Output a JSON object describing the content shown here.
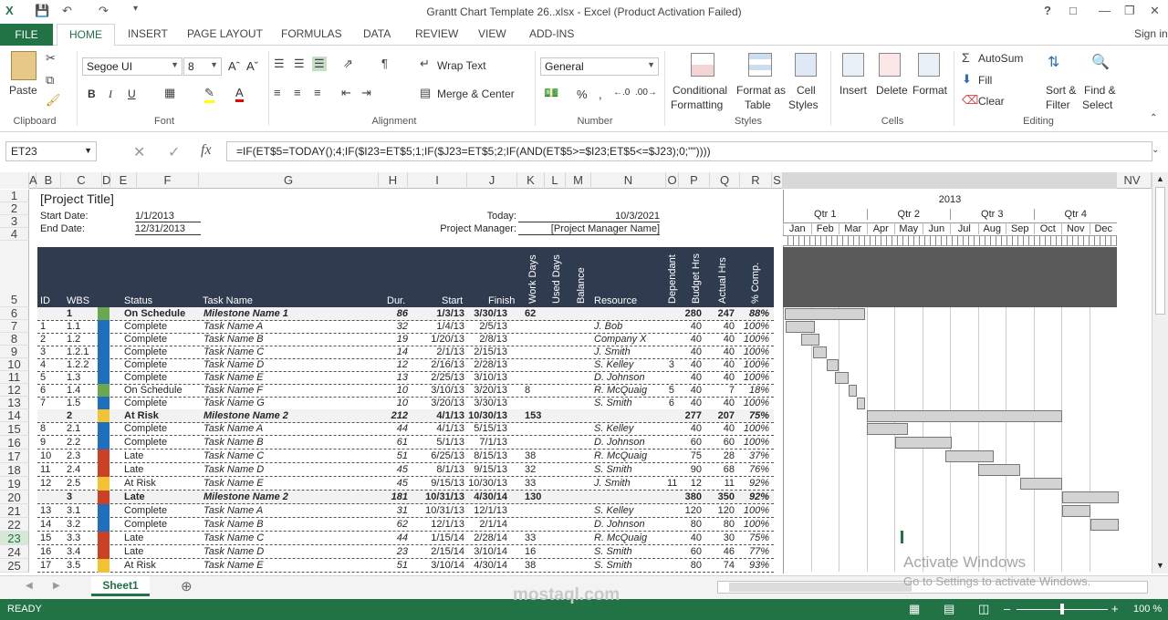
{
  "window": {
    "title": "Grantt Chart Template 26..xlsx - Excel (Product Activation Failed)",
    "help": "?",
    "signin": "Sign in"
  },
  "tabs": [
    "FILE",
    "HOME",
    "INSERT",
    "PAGE LAYOUT",
    "FORMULAS",
    "DATA",
    "REVIEW",
    "VIEW",
    "ADD-INS"
  ],
  "ribbon": {
    "clipboard": {
      "paste": "Paste",
      "label": "Clipboard"
    },
    "font": {
      "name": "Segoe UI",
      "size": "8",
      "label": "Font",
      "bold": "B",
      "italic": "I",
      "underline": "U"
    },
    "alignment": {
      "wrap": "Wrap Text",
      "merge": "Merge & Center",
      "label": "Alignment"
    },
    "number": {
      "format": "General",
      "label": "Number",
      "percent": "%"
    },
    "styles": {
      "cond1": "Conditional",
      "cond2": "Formatting",
      "fmt1": "Format as",
      "fmt2": "Table",
      "cell1": "Cell",
      "cell2": "Styles",
      "label": "Styles"
    },
    "cells": {
      "insert": "Insert",
      "delete": "Delete",
      "format": "Format",
      "label": "Cells"
    },
    "editing": {
      "autosum": "AutoSum",
      "fill": "Fill",
      "clear": "Clear",
      "sort1": "Sort &",
      "sort2": "Filter",
      "find1": "Find &",
      "find2": "Select",
      "label": "Editing"
    }
  },
  "formula_bar": {
    "name_box": "ET23",
    "fx": "fx",
    "formula": "=IF(ET$5=TODAY();4;IF($I23=ET$5;1;IF($J23=ET$5;2;IF(AND(ET$5>=$I23;ET$5<=$J23);0;\"\"))))"
  },
  "columns": [
    "A",
    "B",
    "C",
    "D",
    "E",
    "F",
    "G",
    "H",
    "I",
    "J",
    "K",
    "L",
    "M",
    "N",
    "O",
    "P",
    "Q",
    "R",
    "S",
    "NV"
  ],
  "rows": [
    "1",
    "2",
    "3",
    "4",
    "5",
    "6",
    "7",
    "8",
    "9",
    "10",
    "11",
    "12",
    "13",
    "14",
    "15",
    "16",
    "17",
    "18",
    "19",
    "20",
    "21",
    "22",
    "23",
    "24",
    "25"
  ],
  "sheet": {
    "project_title": "[Project Title]",
    "start_label": "Start Date:",
    "start_date": "1/1/2013",
    "end_label": "End Date:",
    "end_date": "12/31/2013",
    "today_label": "Today:",
    "today": "10/3/2021",
    "pm_label": "Project Manager:",
    "pm": "[Project Manager Name]",
    "headers": {
      "id": "ID",
      "wbs": "WBS",
      "status": "Status",
      "task": "Task Name",
      "dur": "Dur.",
      "start": "Start",
      "finish": "Finish",
      "workdays": "Work Days",
      "useddays": "Used Days",
      "balance": "Balance",
      "resource": "Resource",
      "dependant": "Dependant",
      "budget": "Budget Hrs",
      "actual": "Actual Hrs",
      "pct": "% Comp."
    }
  },
  "tasks": [
    {
      "id": "",
      "wbs": "1",
      "status": "On Schedule",
      "color": "#6aa84f",
      "task": "Milestone Name 1",
      "dur": "86",
      "start": "1/3/13",
      "finish": "3/30/13",
      "work": "62",
      "dep": "",
      "res": "",
      "budget": "280",
      "actual": "247",
      "pct": "88%",
      "ms": true,
      "g": [
        0.0,
        0.0,
        0.24
      ]
    },
    {
      "id": "1",
      "wbs": "1.1",
      "status": "Complete",
      "color": "#1f6fbf",
      "task": "Task Name A",
      "dur": "32",
      "start": "1/4/13",
      "finish": "2/5/13",
      "work": "",
      "dep": "",
      "res": "J. Bob",
      "budget": "40",
      "actual": "40",
      "pct": "100%",
      "ms": false,
      "g": [
        0.003,
        0.09
      ]
    },
    {
      "id": "2",
      "wbs": "1.2",
      "status": "Complete",
      "color": "#1f6fbf",
      "task": "Task Name B",
      "dur": "19",
      "start": "1/20/13",
      "finish": "2/8/13",
      "work": "",
      "dep": "",
      "res": "Company X",
      "budget": "40",
      "actual": "40",
      "pct": "100%",
      "ms": false,
      "g": [
        0.05,
        0.105
      ]
    },
    {
      "id": "3",
      "wbs": "1.2.1",
      "status": "Complete",
      "color": "#1f6fbf",
      "task": "Task Name C",
      "dur": "14",
      "start": "2/1/13",
      "finish": "2/15/13",
      "work": "",
      "dep": "",
      "res": "J. Smith",
      "budget": "40",
      "actual": "40",
      "pct": "100%",
      "ms": false,
      "g": [
        0.085,
        0.125
      ]
    },
    {
      "id": "4",
      "wbs": "1.2.2",
      "status": "Complete",
      "color": "#1f6fbf",
      "task": "Task Name D",
      "dur": "12",
      "start": "2/16/13",
      "finish": "2/28/13",
      "work": "",
      "dep": "3",
      "res": "S. Kelley",
      "budget": "40",
      "actual": "40",
      "pct": "100%",
      "ms": false,
      "g": [
        0.125,
        0.16
      ]
    },
    {
      "id": "5",
      "wbs": "1.3",
      "status": "Complete",
      "color": "#1f6fbf",
      "task": "Task Name E",
      "dur": "13",
      "start": "2/25/13",
      "finish": "3/10/13",
      "work": "",
      "dep": "",
      "res": "D. Johnson",
      "budget": "40",
      "actual": "40",
      "pct": "100%",
      "ms": false,
      "g": [
        0.15,
        0.19
      ]
    },
    {
      "id": "6",
      "wbs": "1.4",
      "status": "On Schedule",
      "color": "#6aa84f",
      "task": "Task Name F",
      "dur": "10",
      "start": "3/10/13",
      "finish": "3/20/13",
      "work": "8",
      "dep": "5",
      "res": "R. McQuaig",
      "budget": "40",
      "actual": "7",
      "pct": "18%",
      "ms": false,
      "g": [
        0.19,
        0.215
      ]
    },
    {
      "id": "7",
      "wbs": "1.5",
      "status": "Complete",
      "color": "#1f6fbf",
      "task": "Task Name G",
      "dur": "10",
      "start": "3/20/13",
      "finish": "3/30/13",
      "work": "",
      "dep": "6",
      "res": "S. Smith",
      "budget": "40",
      "actual": "40",
      "pct": "100%",
      "ms": false,
      "g": [
        0.215,
        0.24
      ]
    },
    {
      "id": "",
      "wbs": "2",
      "status": "At Risk",
      "color": "#f1c232",
      "task": "Milestone Name 2",
      "dur": "212",
      "start": "4/1/13",
      "finish": "10/30/13",
      "work": "153",
      "dep": "",
      "res": "",
      "budget": "277",
      "actual": "207",
      "pct": "75%",
      "ms": true,
      "g": [
        0.245,
        0.83
      ]
    },
    {
      "id": "8",
      "wbs": "2.1",
      "status": "Complete",
      "color": "#1f6fbf",
      "task": "Task Name A",
      "dur": "44",
      "start": "4/1/13",
      "finish": "5/15/13",
      "work": "",
      "dep": "",
      "res": "S. Kelley",
      "budget": "40",
      "actual": "40",
      "pct": "100%",
      "ms": false,
      "g": [
        0.245,
        0.37
      ]
    },
    {
      "id": "9",
      "wbs": "2.2",
      "status": "Complete",
      "color": "#1f6fbf",
      "task": "Task Name B",
      "dur": "61",
      "start": "5/1/13",
      "finish": "7/1/13",
      "work": "",
      "dep": "",
      "res": "D. Johnson",
      "budget": "60",
      "actual": "60",
      "pct": "100%",
      "ms": false,
      "g": [
        0.33,
        0.5
      ]
    },
    {
      "id": "10",
      "wbs": "2.3",
      "status": "Late",
      "color": "#cc4125",
      "task": "Task Name C",
      "dur": "51",
      "start": "6/25/13",
      "finish": "8/15/13",
      "work": "38",
      "dep": "",
      "res": "R. McQuaig",
      "budget": "75",
      "actual": "28",
      "pct": "37%",
      "ms": false,
      "g": [
        0.48,
        0.625
      ]
    },
    {
      "id": "11",
      "wbs": "2.4",
      "status": "Late",
      "color": "#cc4125",
      "task": "Task Name D",
      "dur": "45",
      "start": "8/1/13",
      "finish": "9/15/13",
      "work": "32",
      "dep": "",
      "res": "S. Smith",
      "budget": "90",
      "actual": "68",
      "pct": "76%",
      "ms": false,
      "g": [
        0.58,
        0.705
      ]
    },
    {
      "id": "12",
      "wbs": "2.5",
      "status": "At Risk",
      "color": "#f1c232",
      "task": "Task Name E",
      "dur": "45",
      "start": "9/15/13",
      "finish": "10/30/13",
      "work": "33",
      "dep": "11",
      "res": "J. Smith",
      "budget": "12",
      "actual": "11",
      "pct": "92%",
      "ms": false,
      "g": [
        0.705,
        0.83
      ]
    },
    {
      "id": "",
      "wbs": "3",
      "status": "Late",
      "color": "#cc4125",
      "task": "Milestone Name 2",
      "dur": "181",
      "start": "10/31/13",
      "finish": "4/30/14",
      "work": "130",
      "dep": "",
      "res": "",
      "budget": "380",
      "actual": "350",
      "pct": "92%",
      "ms": true,
      "g": [
        0.83,
        1.0
      ]
    },
    {
      "id": "13",
      "wbs": "3.1",
      "status": "Complete",
      "color": "#1f6fbf",
      "task": "Task Name A",
      "dur": "31",
      "start": "10/31/13",
      "finish": "12/1/13",
      "work": "",
      "dep": "",
      "res": "S. Kelley",
      "budget": "120",
      "actual": "120",
      "pct": "100%",
      "ms": false,
      "g": [
        0.83,
        0.915
      ]
    },
    {
      "id": "14",
      "wbs": "3.2",
      "status": "Complete",
      "color": "#1f6fbf",
      "task": "Task Name B",
      "dur": "62",
      "start": "12/1/13",
      "finish": "2/1/14",
      "work": "",
      "dep": "",
      "res": "D. Johnson",
      "budget": "80",
      "actual": "80",
      "pct": "100%",
      "ms": false,
      "g": [
        0.915,
        1.0
      ]
    },
    {
      "id": "15",
      "wbs": "3.3",
      "status": "Late",
      "color": "#cc4125",
      "task": "Task Name C",
      "dur": "44",
      "start": "1/15/14",
      "finish": "2/28/14",
      "work": "33",
      "dep": "",
      "res": "R. McQuaig",
      "budget": "40",
      "actual": "30",
      "pct": "75%",
      "ms": false,
      "g": null
    },
    {
      "id": "16",
      "wbs": "3.4",
      "status": "Late",
      "color": "#cc4125",
      "task": "Task Name D",
      "dur": "23",
      "start": "2/15/14",
      "finish": "3/10/14",
      "work": "16",
      "dep": "",
      "res": "S. Smith",
      "budget": "60",
      "actual": "46",
      "pct": "77%",
      "ms": false,
      "g": null
    },
    {
      "id": "17",
      "wbs": "3.5",
      "status": "At Risk",
      "color": "#f1c232",
      "task": "Task Name E",
      "dur": "51",
      "start": "3/10/14",
      "finish": "4/30/14",
      "work": "38",
      "dep": "",
      "res": "S. Smith",
      "budget": "80",
      "actual": "74",
      "pct": "93%",
      "ms": false,
      "g": null
    }
  ],
  "gantt": {
    "year": "2013",
    "quarters": [
      "Qtr 1",
      "Qtr 2",
      "Qtr 3",
      "Qtr 4"
    ],
    "months": [
      "Jan",
      "Feb",
      "Mar",
      "Apr",
      "May",
      "Jun",
      "Jul",
      "Aug",
      "Sep",
      "Oct",
      "Nov",
      "Dec"
    ]
  },
  "overlay": {
    "activate1": "Activate Windows",
    "activate2": "Go to Settings to activate Windows.",
    "watermark": "mostaql.com"
  },
  "sheettab": "Sheet1",
  "status": {
    "ready": "READY",
    "zoom": "100 %"
  }
}
